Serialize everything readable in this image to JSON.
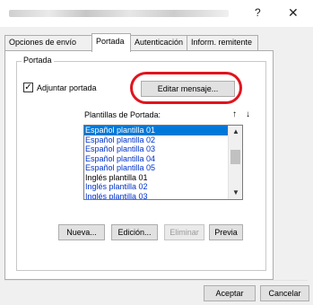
{
  "window": {
    "help_glyph": "?",
    "close_glyph": "✕"
  },
  "tabs": [
    {
      "label": "Opciones de envío",
      "active": false
    },
    {
      "label": "Portada",
      "active": true
    },
    {
      "label": "Autenticación",
      "active": false
    },
    {
      "label": "Inform. remitente",
      "active": false
    }
  ],
  "group": {
    "legend": "Portada",
    "checkbox": {
      "label": "Adjuntar portada",
      "checked": true,
      "mark": "✓"
    },
    "edit_message_button": "Editar mensaje...",
    "templates_label": "Plantillas de Portada:",
    "move_up_glyph": "↑",
    "move_down_glyph": "↓",
    "templates": [
      {
        "label": "Español plantilla 01",
        "state": "selected"
      },
      {
        "label": "Español plantilla 02",
        "state": "normal"
      },
      {
        "label": "Español plantilla 03",
        "state": "normal"
      },
      {
        "label": "Español plantilla 04",
        "state": "normal"
      },
      {
        "label": "Español plantilla 05",
        "state": "normal"
      },
      {
        "label": "Inglés plantilla 01",
        "state": "plain"
      },
      {
        "label": "Inglés plantilla 02",
        "state": "normal"
      },
      {
        "label": "Inglés plantilla 03",
        "state": "normal"
      }
    ],
    "scroll_up_glyph": "▲",
    "scroll_down_glyph": "▼",
    "buttons": {
      "new": "Nueva...",
      "edit": "Edición...",
      "delete": "Eliminar",
      "preview": "Previa"
    }
  },
  "footer": {
    "accept": "Aceptar",
    "cancel": "Cancelar"
  },
  "colors": {
    "highlight_ellipse": "#e0141e",
    "selection": "#0078d7",
    "link_text": "#0033cc"
  }
}
